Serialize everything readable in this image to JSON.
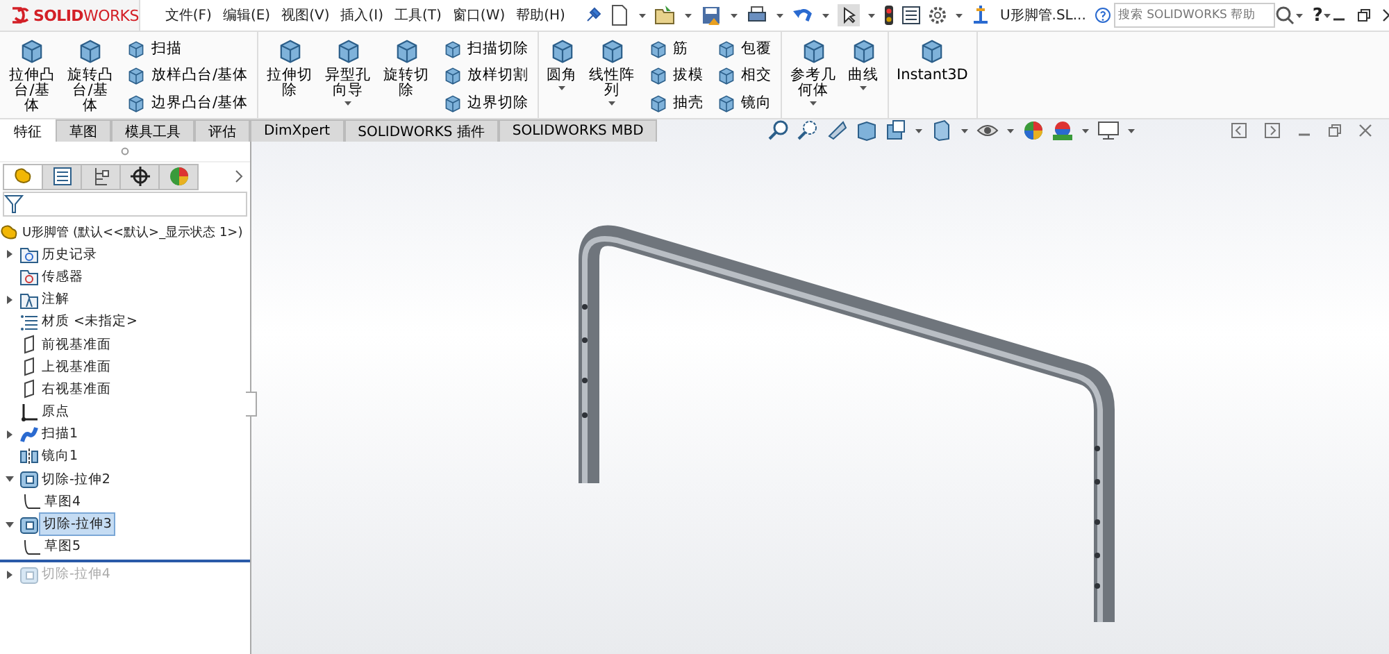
{
  "app": {
    "logo": "**SOLID**WORKS"
  },
  "menu": [
    {
      "label": "文件(F)"
    },
    {
      "label": "编辑(E)"
    },
    {
      "label": "视图(V)"
    },
    {
      "label": "插入(I)"
    },
    {
      "label": "工具(T)"
    },
    {
      "label": "窗口(W)"
    },
    {
      "label": "帮助(H)"
    }
  ],
  "document_title": "U形脚管.SL...",
  "search": {
    "placeholder": "搜索 SOLIDWORKS 帮助"
  },
  "help_label": "?",
  "ribbon": [
    {
      "columns": [
        {
          "kind": "large",
          "label": "拉伸凸台/基体",
          "dropdown": false
        },
        {
          "kind": "large",
          "label": "旋转凸台/基体",
          "dropdown": false
        },
        {
          "kind": "stack",
          "items": [
            {
              "label": "扫描"
            },
            {
              "label": "放样凸台/基体"
            },
            {
              "label": "边界凸台/基体"
            }
          ]
        }
      ]
    },
    {
      "columns": [
        {
          "kind": "large",
          "label": "拉伸切除",
          "dropdown": false
        },
        {
          "kind": "large",
          "label": "异型孔向导",
          "dropdown": true
        },
        {
          "kind": "large",
          "label": "旋转切除",
          "dropdown": false
        },
        {
          "kind": "stack",
          "items": [
            {
              "label": "扫描切除"
            },
            {
              "label": "放样切割"
            },
            {
              "label": "边界切除"
            }
          ]
        }
      ]
    },
    {
      "columns": [
        {
          "kind": "large",
          "label": "圆角",
          "dropdown": true
        },
        {
          "kind": "large",
          "label": "线性阵列",
          "dropdown": true
        },
        {
          "kind": "stack",
          "items": [
            {
              "label": "筋"
            },
            {
              "label": "拔模"
            },
            {
              "label": "抽壳"
            }
          ]
        },
        {
          "kind": "stack",
          "items": [
            {
              "label": "包覆"
            },
            {
              "label": "相交"
            },
            {
              "label": "镜向"
            }
          ]
        }
      ]
    },
    {
      "columns": [
        {
          "kind": "large",
          "label": "参考几何体",
          "dropdown": true
        },
        {
          "kind": "large",
          "label": "曲线",
          "dropdown": true
        }
      ]
    },
    {
      "columns": [
        {
          "kind": "large",
          "label": "Instant3D",
          "dropdown": false
        }
      ]
    }
  ],
  "tabs": [
    {
      "label": "特征",
      "selected": true
    },
    {
      "label": "草图",
      "selected": false
    },
    {
      "label": "模具工具",
      "selected": false
    },
    {
      "label": "评估",
      "selected": false
    },
    {
      "label": "DimXpert",
      "selected": false
    },
    {
      "label": "SOLIDWORKS 插件",
      "selected": false
    },
    {
      "label": "SOLIDWORKS MBD",
      "selected": false
    }
  ],
  "panel_tabs": [
    {
      "selected": true
    },
    {
      "selected": false
    },
    {
      "selected": false
    },
    {
      "selected": false
    },
    {
      "selected": false
    }
  ],
  "tree": {
    "root": "U形脚管  (默认<<默认>_显示状态 1>)",
    "items": [
      {
        "kind": "folder",
        "label": "历史记录",
        "expanded": false,
        "selected": false,
        "rolled_back": false
      },
      {
        "kind": "sensor",
        "label": "传感器",
        "selected": false,
        "rolled_back": false
      },
      {
        "kind": "annotation",
        "label": "注解",
        "expanded": false,
        "selected": false,
        "rolled_back": false
      },
      {
        "kind": "material",
        "label": "材质 <未指定>",
        "selected": false,
        "rolled_back": false
      },
      {
        "kind": "plane",
        "label": "前视基准面",
        "selected": false,
        "rolled_back": false
      },
      {
        "kind": "plane",
        "label": "上视基准面",
        "selected": false,
        "rolled_back": false
      },
      {
        "kind": "plane",
        "label": "右视基准面",
        "selected": false,
        "rolled_back": false
      },
      {
        "kind": "origin",
        "label": "原点",
        "selected": false,
        "rolled_back": false
      },
      {
        "kind": "sweep",
        "label": "扫描1",
        "expanded": false,
        "selected": false,
        "rolled_back": false
      },
      {
        "kind": "mirror",
        "label": "镜向1",
        "selected": false,
        "rolled_back": false
      },
      {
        "kind": "cut",
        "label": "切除-拉伸2",
        "expanded": true,
        "selected": false,
        "rolled_back": false,
        "children": [
          {
            "kind": "sketch",
            "label": "草图4",
            "selected": false,
            "rolled_back": false
          }
        ]
      },
      {
        "kind": "cut",
        "label": "切除-拉伸3",
        "expanded": true,
        "selected": true,
        "rolled_back": false,
        "children": [
          {
            "kind": "sketch",
            "label": "草图5",
            "selected": false,
            "rolled_back": false
          }
        ]
      },
      {
        "kind": "cut",
        "label": "切除-拉伸4",
        "expanded": false,
        "selected": false,
        "rolled_back": true
      }
    ]
  }
}
